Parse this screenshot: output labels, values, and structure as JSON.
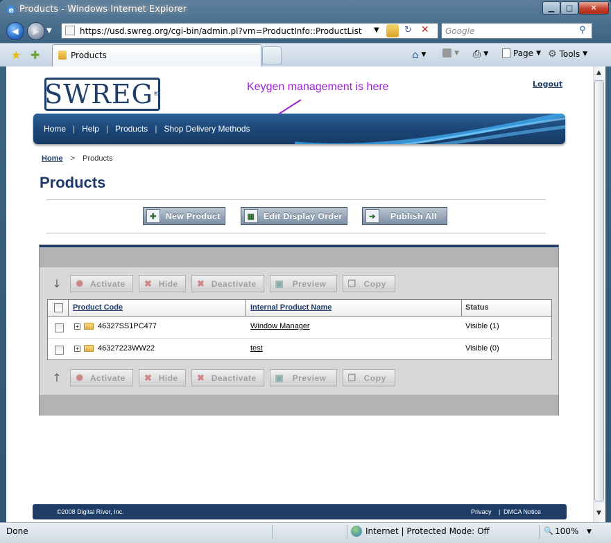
{
  "window": {
    "title": "Products - Windows Internet Explorer"
  },
  "address": {
    "url": "https://usd.swreg.org/cgi-bin/admin.pl?vm=ProductInfo::ProductList",
    "search_placeholder": "Google"
  },
  "tab": {
    "label": "Products"
  },
  "commandbar": {
    "page": "Page",
    "tools": "Tools"
  },
  "status": {
    "left": "Done",
    "zone": "Internet | Protected Mode: Off",
    "zoom": "100%"
  },
  "page": {
    "logo": "SWREG",
    "logout": "Logout",
    "annotation": "Keygen management is here",
    "nav": [
      "Home",
      "Help",
      "Products",
      "Shop Delivery Methods"
    ],
    "breadcrumb": {
      "home": "Home",
      "sep": ">",
      "current": "Products"
    },
    "heading": "Products",
    "buttons": {
      "new_product": "New Product",
      "edit_display_order": "Edit Display Order",
      "publish_all": "Publish All"
    },
    "toolbar": {
      "activate": "Activate",
      "hide": "Hide",
      "deactivate": "Deactivate",
      "preview": "Preview",
      "copy": "Copy"
    },
    "table": {
      "headers": {
        "code": "Product Code",
        "name": "Internal Product Name",
        "status": "Status"
      },
      "rows": [
        {
          "code": "46327SS1PC477",
          "name": "Window Manager",
          "status": "Visible (1)"
        },
        {
          "code": "46327223WW22",
          "name": "test",
          "status": "Visible (0)"
        }
      ]
    },
    "footer": {
      "copyright": "©2008 Digital River, Inc.",
      "privacy": "Privacy",
      "sep": "|",
      "dmca": "DMCA Notice"
    }
  }
}
